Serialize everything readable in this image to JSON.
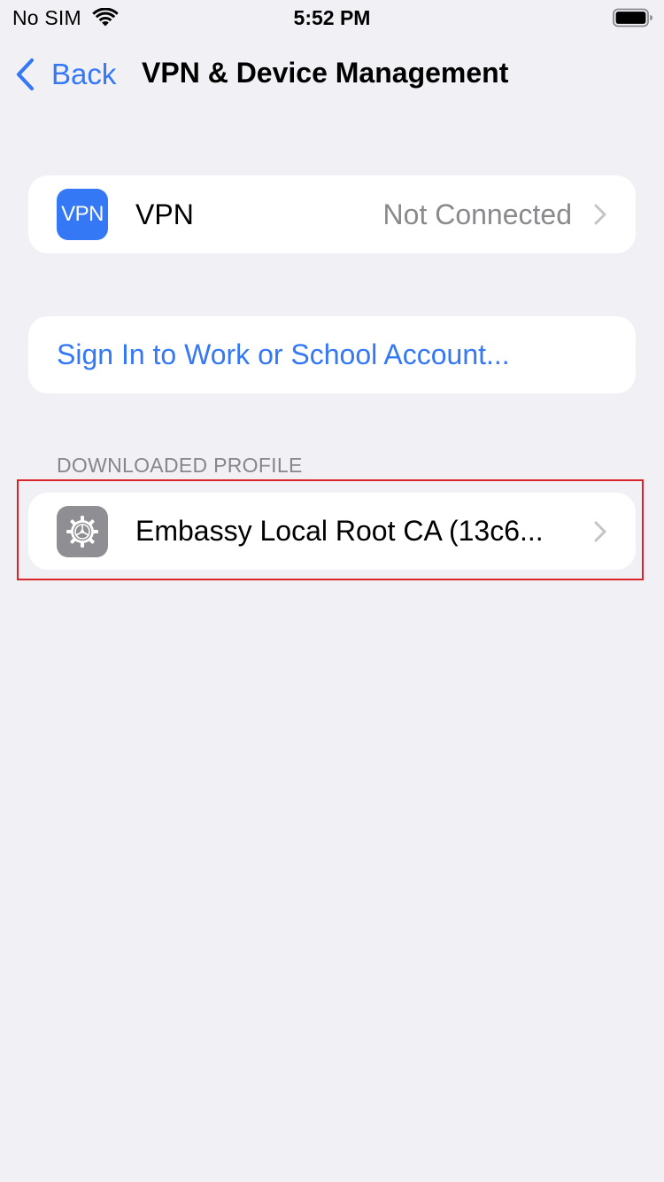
{
  "status_bar": {
    "carrier": "No SIM",
    "time": "5:52 PM",
    "icons": [
      "wifi-icon",
      "battery-icon"
    ]
  },
  "nav": {
    "back_label": "Back",
    "title": "VPN & Device Management",
    "back_icon": "chevron-left-icon"
  },
  "vpn_row": {
    "icon_text": "VPN",
    "label": "VPN",
    "value": "Not Connected",
    "icon": "chevron-right-icon"
  },
  "signin_row": {
    "label": "Sign In to Work or School Account..."
  },
  "downloaded_profile": {
    "header": "DOWNLOADED PROFILE",
    "label": "Embassy Local Root CA (13c6...",
    "icon": "settings-gear-icon"
  },
  "colors": {
    "accent": "#3478f6",
    "background": "#f0f0f5",
    "secondary_text": "#8a8a8e",
    "highlight": "#d9262b",
    "settings_icon_bg": "#8e8e93"
  }
}
